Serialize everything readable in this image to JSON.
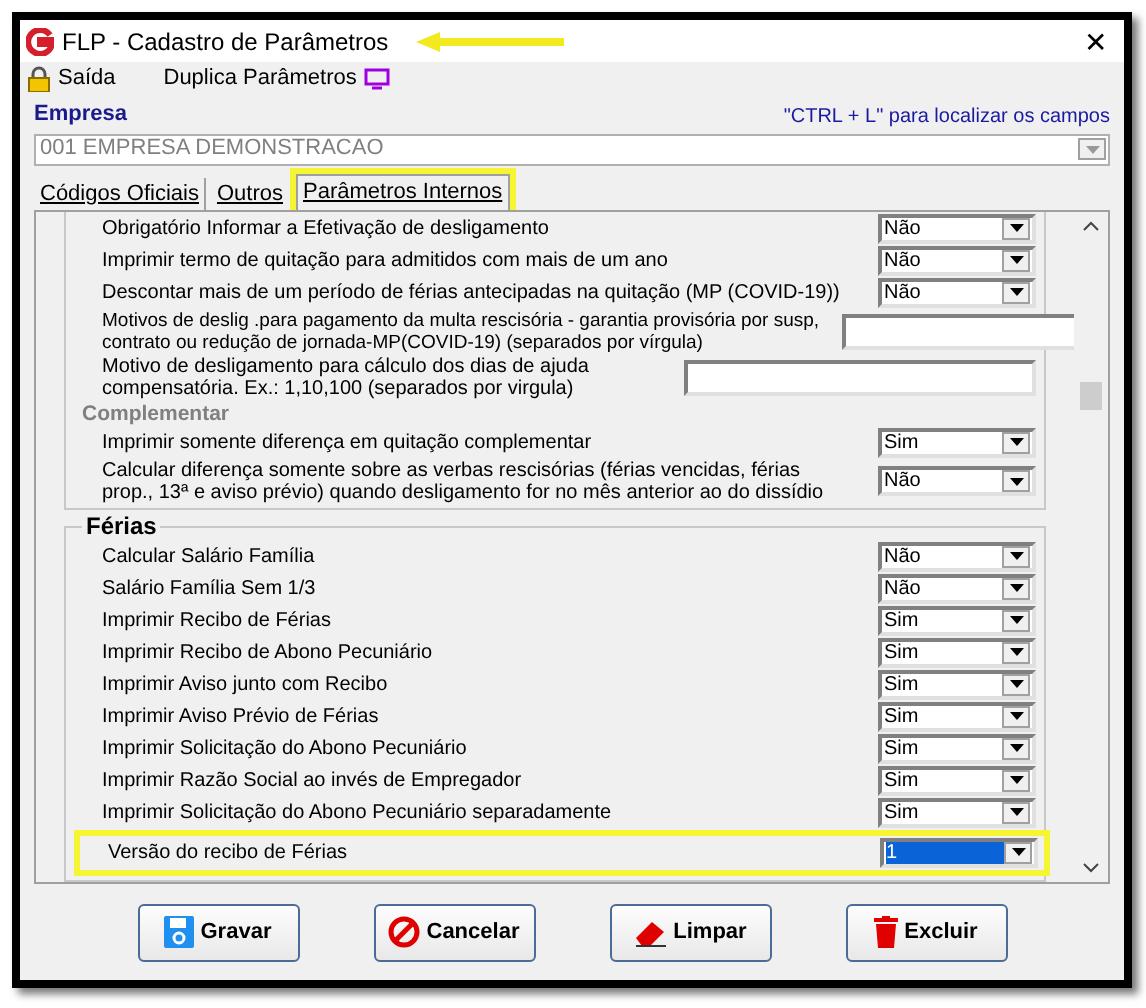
{
  "window": {
    "title": "FLP - Cadastro de Parâmetros",
    "annotated": true,
    "close": "✕"
  },
  "toolbar": [
    {
      "label": "Saída",
      "kind": "lock"
    },
    {
      "label": "Duplica Parâmetros",
      "kind": "monitor"
    }
  ],
  "empresa": {
    "label": "Empresa",
    "hint": "\"CTRL + L\" para localizar os campos",
    "value": "001 EMPRESA DEMONSTRACAO"
  },
  "tabs": [
    {
      "label": "Códigos Oficiais",
      "selected": false,
      "highlighted": false
    },
    {
      "label": "Outros",
      "selected": false,
      "highlighted": false
    },
    {
      "label": "Parâmetros Internos",
      "selected": true,
      "highlighted": true
    }
  ],
  "groups": [
    {
      "items": [
        {
          "kind": "select",
          "label": "Obrigatório Informar a Efetivação de desligamento",
          "value": "Não"
        },
        {
          "kind": "select",
          "label": "Imprimir termo de quitação para admitidos com mais de um ano",
          "value": "Não"
        },
        {
          "kind": "select",
          "label": "Descontar mais de um período de férias antecipadas na quitação (MP (COVID-19))",
          "value": "Não"
        },
        {
          "kind": "wide-text",
          "label": "Motivos de deslig .para pagamento da multa rescisória - garantia provisória por susp, contrato ou redução de jornada-MP(COVID-19) (separados por vírgula)"
        },
        {
          "kind": "text",
          "label": "Motivo de desligamento para cálculo dos dias de ajuda compensatória. Ex.: 1,10,100 (separados por virgula)"
        },
        {
          "kind": "heading",
          "label": "Complementar"
        },
        {
          "kind": "select",
          "label": "Imprimir somente diferença em quitação complementar",
          "value": "Sim"
        },
        {
          "kind": "select",
          "label": "Calcular diferença somente sobre as verbas rescisórias (férias vencidas, férias prop., 13ª e aviso prévio) quando desligamento for no mês anterior ao do dissídio",
          "value": "Não"
        }
      ]
    },
    {
      "title": "Férias",
      "items": [
        {
          "kind": "select",
          "label": "Calcular Salário Família",
          "value": "Não"
        },
        {
          "kind": "select",
          "label": "Salário Família Sem 1/3",
          "value": "Não"
        },
        {
          "kind": "select",
          "label": "Imprimir Recibo de Férias",
          "value": "Sim"
        },
        {
          "kind": "select",
          "label": "Imprimir Recibo de Abono Pecuniário",
          "value": "Sim"
        },
        {
          "kind": "select",
          "label": "Imprimir Aviso junto com Recibo",
          "value": "Sim"
        },
        {
          "kind": "select",
          "label": "Imprimir Aviso Prévio de Férias",
          "value": "Sim"
        },
        {
          "kind": "select",
          "label": "Imprimir Solicitação do Abono Pecuniário",
          "value": "Sim"
        },
        {
          "kind": "select",
          "label": "Imprimir Razão Social ao invés de Empregador",
          "value": "Sim"
        },
        {
          "kind": "select",
          "label": "Imprimir Solicitação do Abono Pecuniário separadamente",
          "value": "Sim"
        },
        {
          "kind": "select",
          "label": "Versão do recibo de Férias",
          "value": "1",
          "highlighted": true
        }
      ]
    }
  ],
  "buttons": [
    {
      "label": "Gravar",
      "kind": "save"
    },
    {
      "label": "Cancelar",
      "kind": "cancel"
    },
    {
      "label": "Limpar",
      "kind": "clear"
    },
    {
      "label": "Excluir",
      "kind": "delete"
    }
  ]
}
